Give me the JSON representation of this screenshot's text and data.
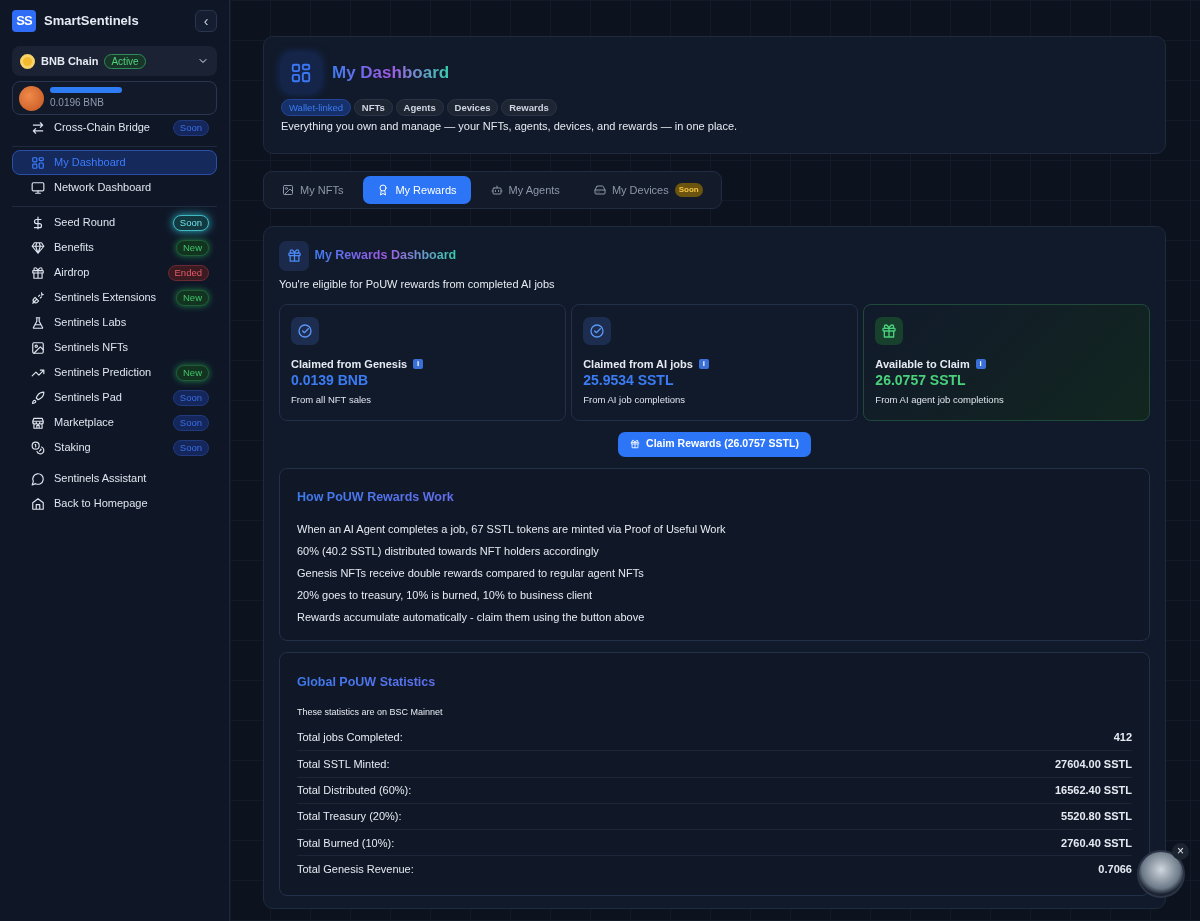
{
  "sidebar": {
    "brand": {
      "logo": "SS",
      "name": "SmartSentinels",
      "collapse": "‹"
    },
    "chain": {
      "name": "BNB Chain",
      "status": "Active"
    },
    "wallet": {
      "balance": "0.0196 BNB"
    },
    "sections": [
      {
        "divider_above": false,
        "items": [
          {
            "label": "Cross-Chain Bridge",
            "selected": false,
            "badge": {
              "text": "Soon",
              "kind": "soon"
            }
          }
        ]
      },
      {
        "divider_above": true,
        "items": [
          {
            "label": "My Dashboard",
            "selected": true
          },
          {
            "label": "Network Dashboard",
            "selected": false
          }
        ]
      },
      {
        "divider_above": true,
        "items": [
          {
            "label": "Seed Round",
            "selected": false,
            "badge": {
              "text": "Soon",
              "kind": "glow"
            }
          },
          {
            "label": "Benefits",
            "selected": false,
            "badge": {
              "text": "New",
              "kind": "new"
            }
          },
          {
            "label": "Airdrop",
            "selected": false,
            "badge": {
              "text": "Ended",
              "kind": "ended"
            }
          },
          {
            "label": "Sentinels Extensions",
            "selected": false,
            "badge": {
              "text": "New",
              "kind": "new"
            }
          },
          {
            "label": "Sentinels Labs",
            "selected": false
          },
          {
            "label": "Sentinels NFTs",
            "selected": false
          },
          {
            "label": "Sentinels Prediction",
            "selected": false,
            "badge": {
              "text": "New",
              "kind": "new"
            }
          },
          {
            "label": "Sentinels Pad",
            "selected": false,
            "badge": {
              "text": "Soon",
              "kind": "soon"
            }
          },
          {
            "label": "Marketplace",
            "selected": false,
            "badge": {
              "text": "Soon",
              "kind": "soon"
            }
          },
          {
            "label": "Staking",
            "selected": false,
            "badge": {
              "text": "Soon",
              "kind": "soon"
            }
          }
        ]
      },
      {
        "divider_above": false,
        "items": [
          {
            "label": "Sentinels Assistant",
            "selected": false
          },
          {
            "label": "Back to Homepage",
            "selected": false
          }
        ]
      }
    ]
  },
  "header": {
    "title": "My Dashboard",
    "tags": [
      {
        "label": "Wallet-linked",
        "highlighted": true
      },
      {
        "label": "NFTs",
        "highlighted": false
      },
      {
        "label": "Agents",
        "highlighted": false
      },
      {
        "label": "Devices",
        "highlighted": false
      },
      {
        "label": "Rewards",
        "highlighted": false
      }
    ],
    "description": "Everything you own and manage — your NFTs, agents, devices, and rewards — in one place."
  },
  "tabs": [
    {
      "label": "My NFTs",
      "selected": false
    },
    {
      "label": "My Rewards",
      "selected": true
    },
    {
      "label": "My Agents",
      "selected": false
    },
    {
      "label": "My Devices",
      "selected": false,
      "badge": "Soon"
    }
  ],
  "rewards": {
    "title": "My Rewards Dashboard",
    "subtitle": "You're eligible for PoUW rewards from completed AI jobs",
    "cards": [
      {
        "kind": "claimed",
        "label": "Claimed from Genesis",
        "info": "i",
        "value": "0.0139 BNB",
        "note": "From all NFT sales"
      },
      {
        "kind": "claimed",
        "label": "Claimed from AI jobs",
        "info": "i",
        "value": "25.9534 SSTL",
        "note": "From AI job completions"
      },
      {
        "kind": "available",
        "label": "Available to Claim",
        "info": "i",
        "value": "26.0757 SSTL",
        "note": "From AI agent job completions"
      }
    ],
    "claim_button": "Claim Rewards (26.0757 SSTL)"
  },
  "how": {
    "title": "How PoUW Rewards Work",
    "items": [
      "When an AI Agent completes a job, 67 SSTL tokens are minted via Proof of Useful Work",
      "60% (40.2 SSTL) distributed towards NFT holders accordingly",
      "Genesis NFTs receive double rewards compared to regular agent NFTs",
      "20% goes to treasury, 10% is burned, 10% to business client",
      "Rewards accumulate automatically - claim them using the button above"
    ]
  },
  "stats": {
    "title": "Global PoUW Statistics",
    "note": "These statistics are on BSC Mainnet",
    "rows": [
      {
        "label": "Total jobs Completed:",
        "value": "412"
      },
      {
        "label": "Total SSTL Minted:",
        "value": "27604.00 SSTL"
      },
      {
        "label": "Total Distributed (60%):",
        "value": "16562.40 SSTL"
      },
      {
        "label": "Total Treasury (20%):",
        "value": "5520.80 SSTL"
      },
      {
        "label": "Total Burned (10%):",
        "value": "2760.40 SSTL"
      },
      {
        "label": "Total Genesis Revenue:",
        "value": "0.7066"
      }
    ]
  },
  "assistant": {
    "close": "×"
  }
}
